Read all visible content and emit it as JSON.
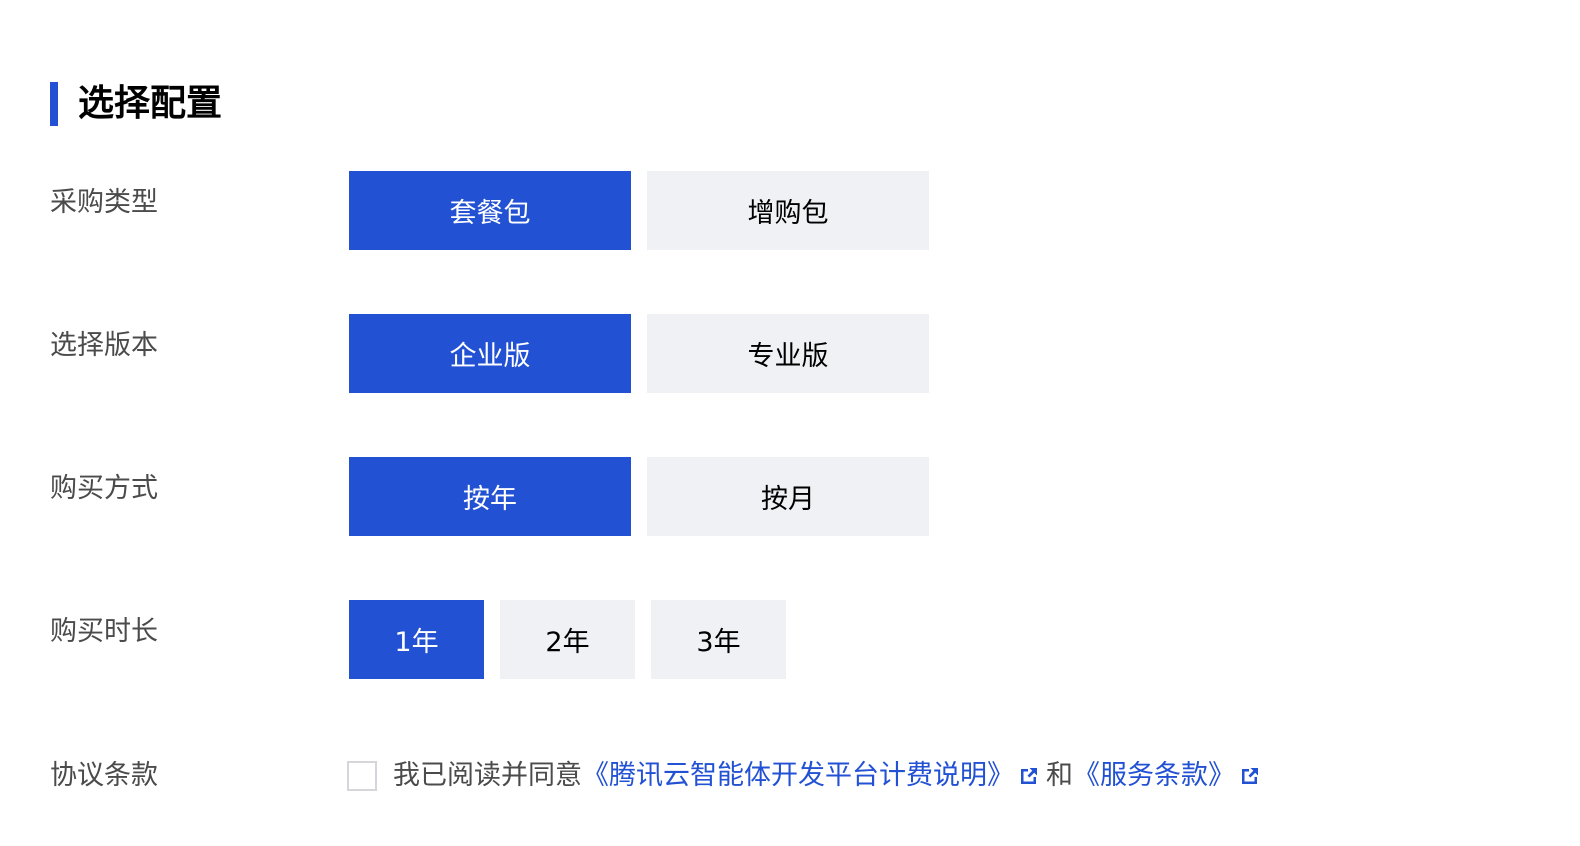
{
  "section": {
    "title": "选择配置"
  },
  "rows": [
    {
      "label": "采购类型",
      "options": [
        {
          "label": "套餐包",
          "selected": true
        },
        {
          "label": "增购包",
          "selected": false
        }
      ]
    },
    {
      "label": "选择版本",
      "options": [
        {
          "label": "企业版",
          "selected": true
        },
        {
          "label": "专业版",
          "selected": false
        }
      ]
    },
    {
      "label": "购买方式",
      "options": [
        {
          "label": "按年",
          "selected": true
        },
        {
          "label": "按月",
          "selected": false
        }
      ]
    },
    {
      "label": "购买时长",
      "options": [
        {
          "label": "1年",
          "selected": true
        },
        {
          "label": "2年",
          "selected": false
        },
        {
          "label": "3年",
          "selected": false
        }
      ]
    }
  ],
  "agreement": {
    "label": "协议条款",
    "checked": false,
    "prefix": "我已阅读并同意",
    "link1": "《腾讯云智能体开发平台计费说明》",
    "link1_icon": "external-link-icon",
    "conjunction": "和",
    "link2": "《服务条款》",
    "link2_icon": "external-link-icon"
  },
  "colors": {
    "accent": "#2251d3",
    "inactive_bg": "#f0f1f5",
    "label_text": "#4b4b4b"
  }
}
